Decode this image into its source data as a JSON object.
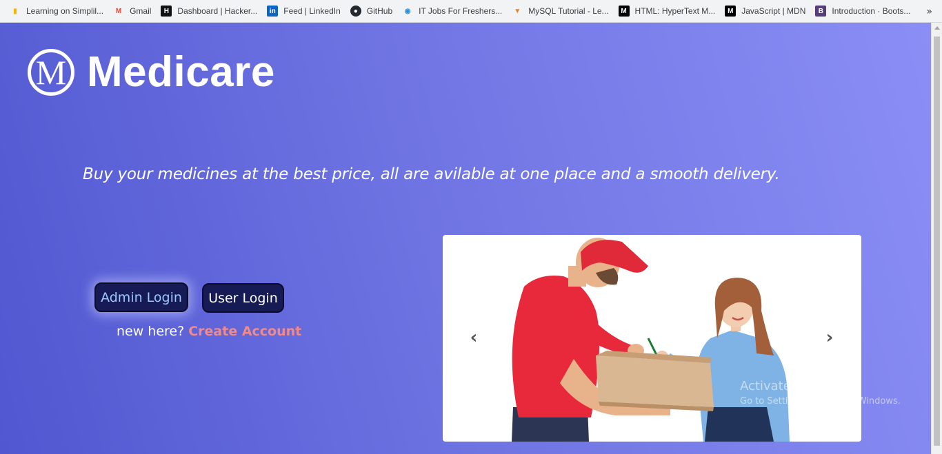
{
  "bookmarks": [
    {
      "label": "Learning on Simplil...",
      "icon": "simplilearn-icon",
      "color": "#f2b705"
    },
    {
      "label": "Gmail",
      "icon": "gmail-icon",
      "color": "#ea4335"
    },
    {
      "label": "Dashboard | Hacker...",
      "icon": "hackerrank-icon",
      "color": "#111111"
    },
    {
      "label": "Feed | LinkedIn",
      "icon": "linkedin-icon",
      "color": "#0a66c2"
    },
    {
      "label": "GitHub",
      "icon": "github-icon",
      "color": "#24292e"
    },
    {
      "label": "IT Jobs For Freshers...",
      "icon": "jobs-icon",
      "color": "#2b8fd9"
    },
    {
      "label": "MySQL Tutorial - Le...",
      "icon": "mysql-tutorial-icon",
      "color": "#e67e22"
    },
    {
      "label": "HTML: HyperText M...",
      "icon": "mdn-icon",
      "color": "#000000"
    },
    {
      "label": "JavaScript | MDN",
      "icon": "mdn-icon",
      "color": "#000000"
    },
    {
      "label": "Introduction · Boots...",
      "icon": "bootstrap-icon",
      "color": "#563d7c"
    }
  ],
  "bookmarks_more": "»",
  "brand": {
    "logo_letter": "M",
    "name": "Medicare"
  },
  "tagline": "Buy your medicines at the best price, all are avilable at one place and a smooth delivery.",
  "buttons": {
    "admin": "Admin Login",
    "user": "User Login"
  },
  "signup": {
    "prompt": "new here?",
    "link": "Create Account"
  },
  "carousel": {
    "prev": "‹",
    "next": "›",
    "image": "delivery-person-handing-box-to-woman-image"
  },
  "watermark": {
    "line1": "Activate Windows",
    "line2": "Go to Settings to activate Windows."
  },
  "colors": {
    "gradient_start": "#5057d0",
    "gradient_end": "#8a8ef5",
    "button_bg": "#161a55",
    "link": "#f08a8a"
  }
}
